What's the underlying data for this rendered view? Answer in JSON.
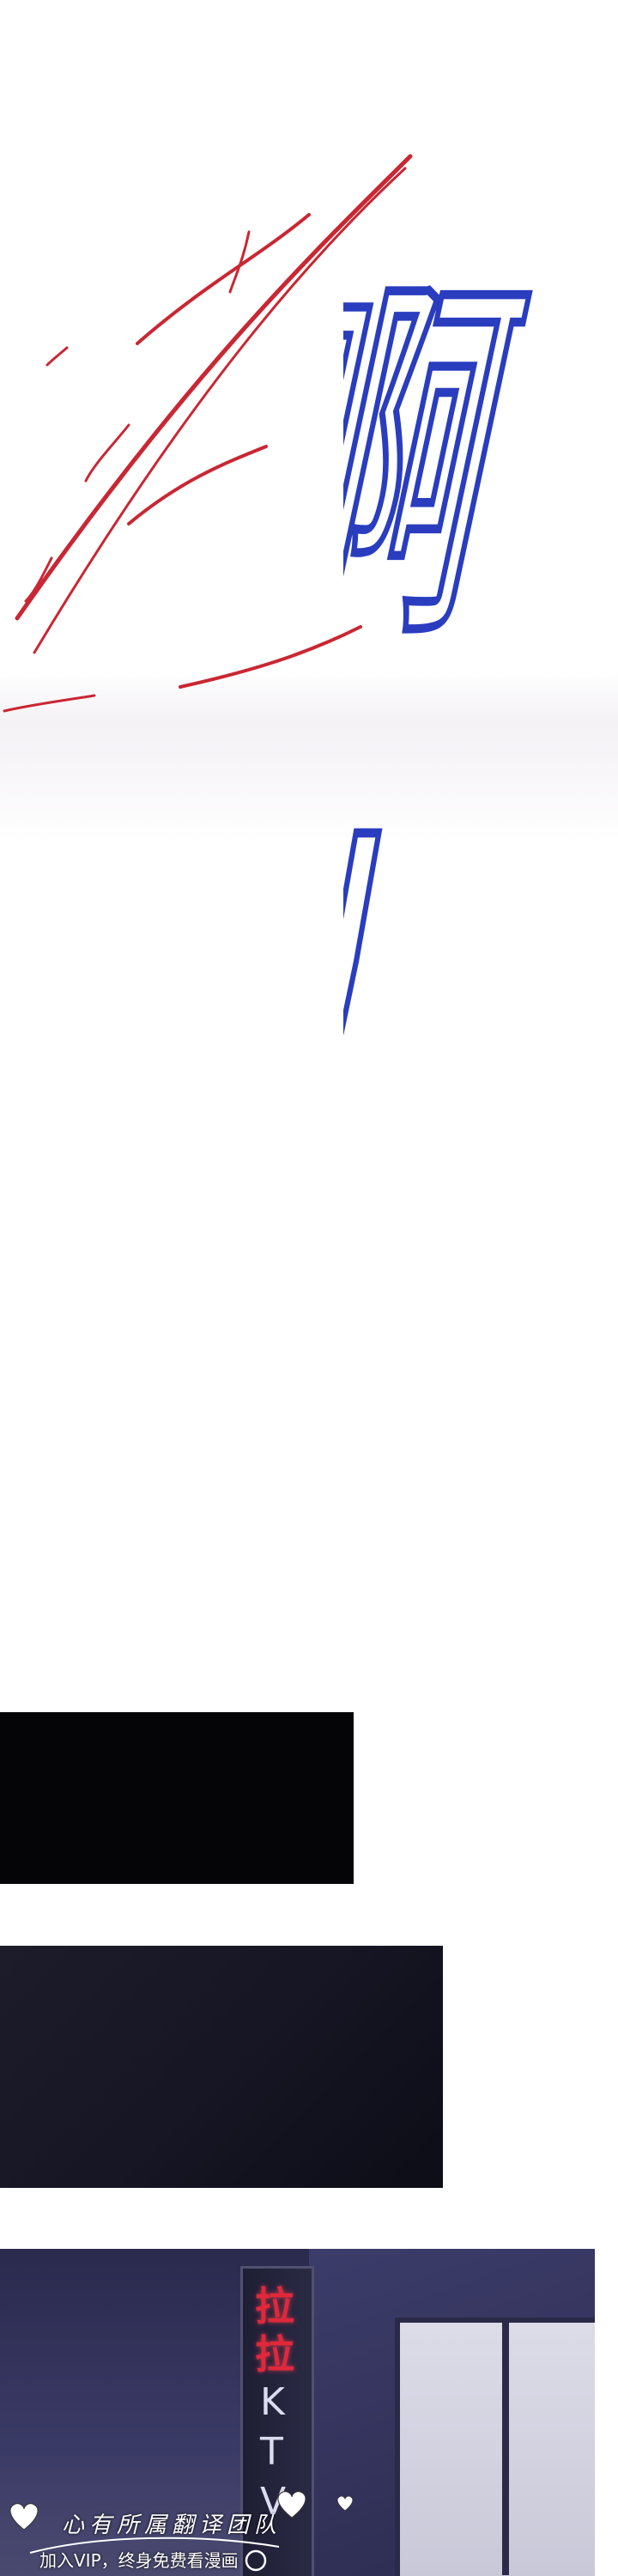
{
  "sfx": {
    "exclamation_chars": [
      "啊",
      "!"
    ]
  },
  "ktv_sign": {
    "chars": [
      "拉",
      "拉"
    ],
    "letters": [
      "K",
      "T",
      "V"
    ]
  },
  "watermark": {
    "group_name": "心有所属翻译团队",
    "vip_text": "加入VIP，终身免费看漫画"
  },
  "colors": {
    "sfx_outline": "#2a3dbf",
    "blood": "#c4101e",
    "sign_red": "#e0283a"
  }
}
